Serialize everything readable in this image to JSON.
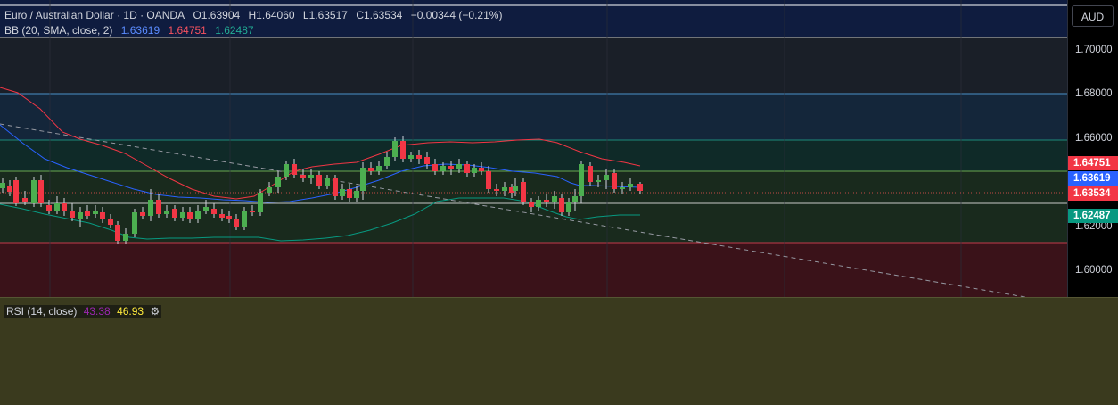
{
  "symbol": {
    "name": "Euro / Australian Dollar",
    "interval": "1D",
    "exchange": "OANDA",
    "separator": " · ",
    "open": "O1.63904",
    "high": "H1.64060",
    "low": "L1.63517",
    "close": "C1.63534",
    "change": "−0.00344 (−0.21%)"
  },
  "bb": {
    "label": "BB (20, SMA, close, 2)",
    "basis": "1.63619",
    "upper": "1.64751",
    "lower": "1.62487"
  },
  "rsi": {
    "label": "RSI (14, close)",
    "value1": "43.38",
    "value2": "46.93"
  },
  "price_axis": {
    "currency": "AUD",
    "ticks": [
      "1.70000",
      "1.68000",
      "1.66000",
      "1.62000",
      "1.60000"
    ],
    "tag_upper": "1.64751",
    "tag_basis": "1.63619",
    "tag_close": "1.63534",
    "tag_lower": "1.62487"
  },
  "colors": {
    "up": "#26a69a",
    "up_bright": "#4caf50",
    "down": "#ef5350",
    "bb_upper": "#f23645",
    "bb_basis": "#2962ff",
    "bb_lower": "#089981"
  }
}
